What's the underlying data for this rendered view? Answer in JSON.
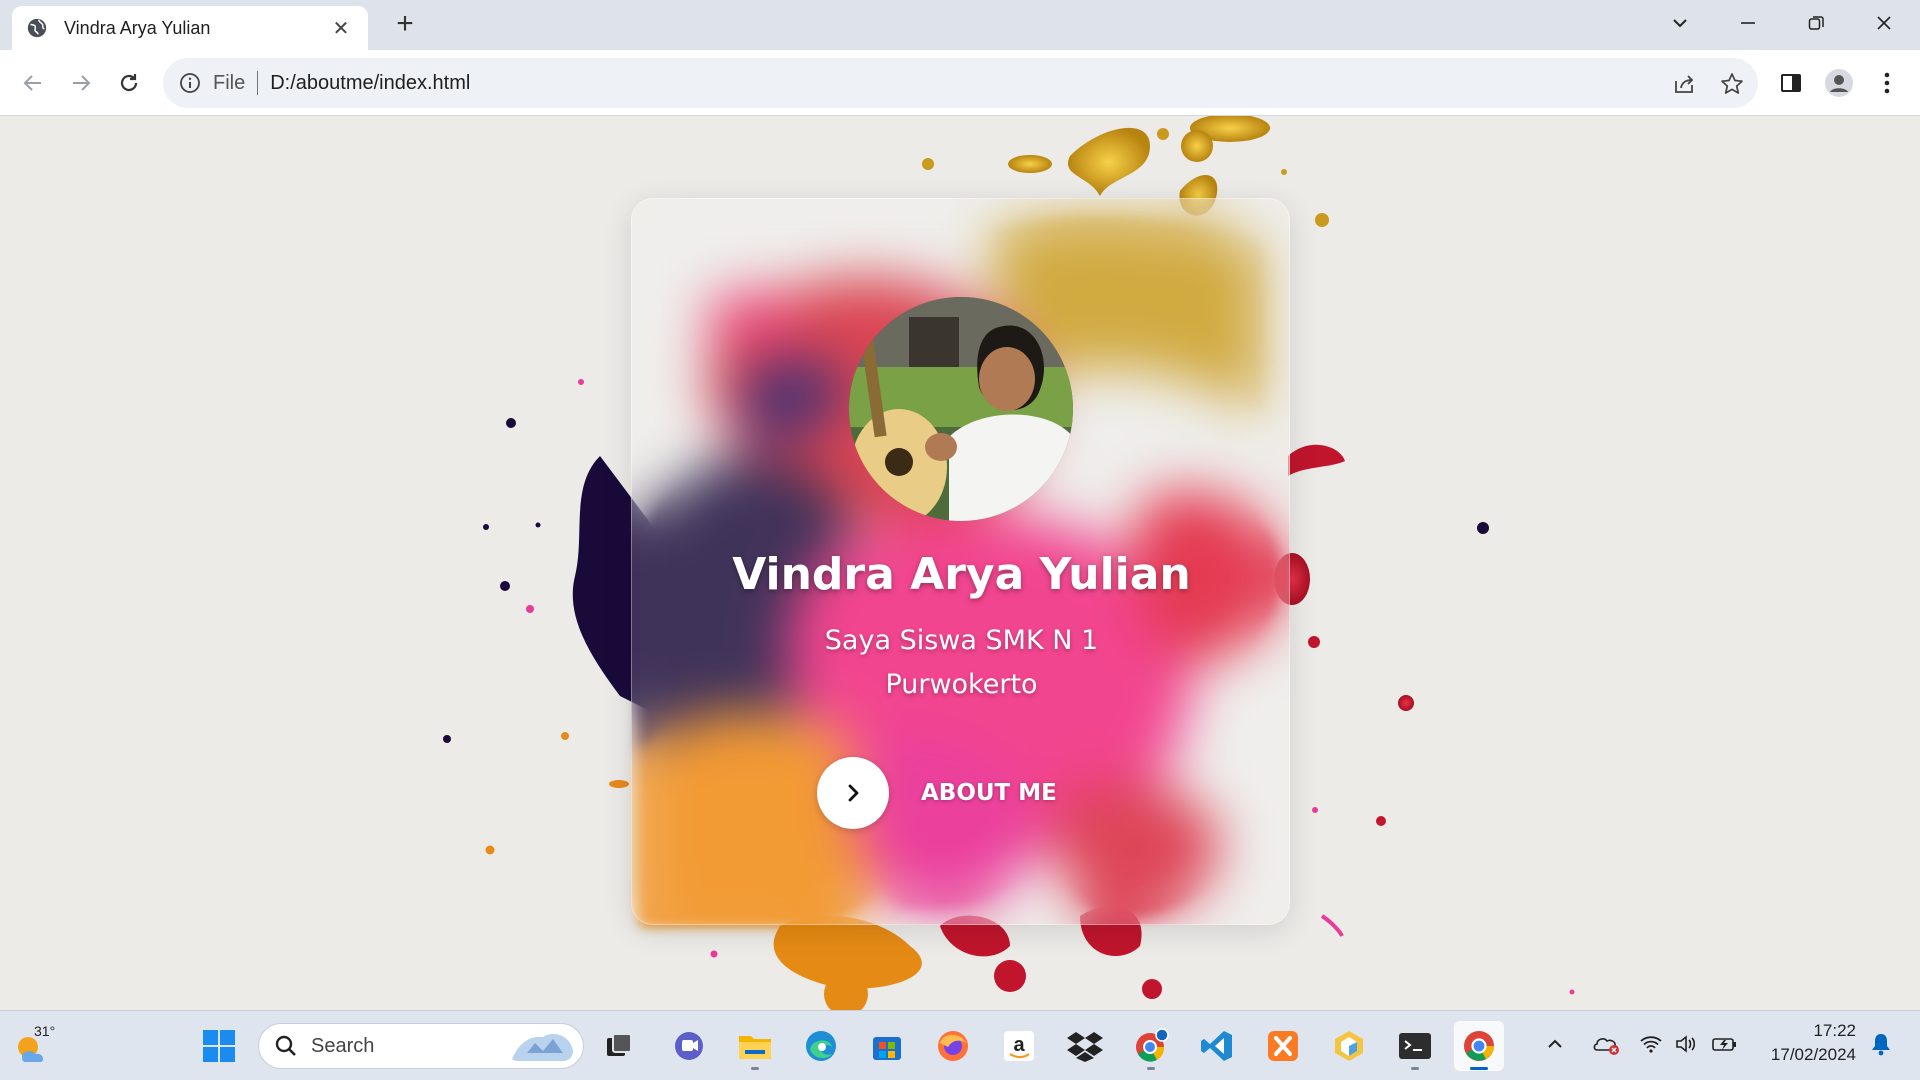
{
  "browser": {
    "tab_title": "Vindra Arya Yulian",
    "url_scheme": "File",
    "url": "D:/aboutme/index.html"
  },
  "profile": {
    "name": "Vindra Arya Yulian",
    "subtitle": "Saya Siswa SMK N 1 Purwokerto",
    "button_label": "ABOUT ME"
  },
  "taskbar": {
    "weather_temp": "31°",
    "search_label": "Search",
    "time": "17:22",
    "date": "17/02/2024",
    "apps": [
      "start-icon",
      "task-view-icon",
      "teams-icon",
      "file-explorer-icon",
      "edge-icon",
      "store-icon",
      "firefox-icon",
      "amazon-icon",
      "dropbox-icon",
      "chrome-profile-icon",
      "vscode-icon",
      "xampp-icon",
      "app-cube-icon",
      "terminal-icon",
      "chrome-icon"
    ]
  },
  "colors": {
    "accent": "#0067c0",
    "chrome_bg": "#dee3eb",
    "page_bg": "#ecebe8"
  }
}
